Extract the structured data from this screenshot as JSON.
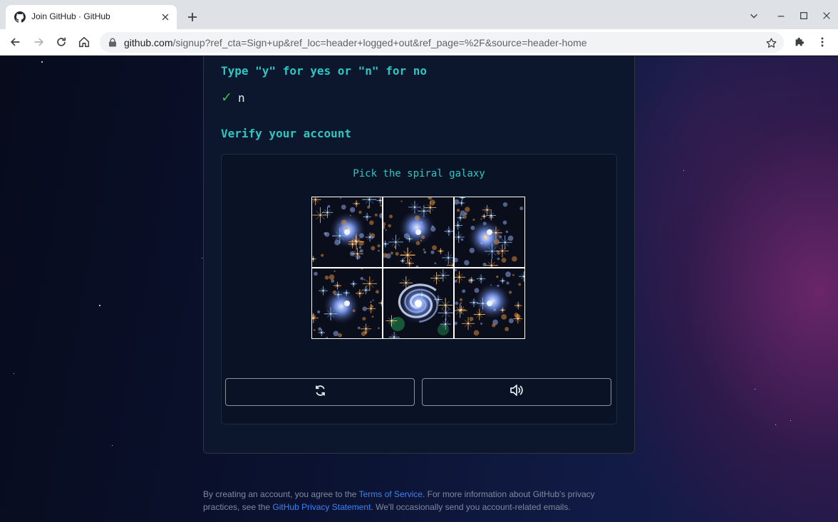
{
  "browser": {
    "tab_title": "Join GitHub · GitHub",
    "url_host": "github.com",
    "url_path": "/signup?ref_cta=Sign+up&ref_loc=header+logged+out&ref_page=%2F&source=header-home"
  },
  "signup": {
    "yes_no_prompt": "Type \"y\" for yes or \"n\" for no",
    "yes_no_answer": "n",
    "verify_title": "Verify your account"
  },
  "captcha": {
    "instruction": "Pick the spiral galaxy",
    "tiles": [
      "star-cluster",
      "star-cluster",
      "star-cluster",
      "star-cluster",
      "spiral-galaxy",
      "star-cluster"
    ]
  },
  "footer": {
    "text_before_terms": "By creating an account, you agree to the ",
    "terms_link": "Terms of Service",
    "text_middle": ". For more information about GitHub's privacy practices, see the ",
    "privacy_link": "GitHub Privacy Statement",
    "text_after": ". We'll occasionally send you account-related emails."
  },
  "colors": {
    "accent_teal": "#2ec7c0",
    "check_green": "#3fb950",
    "link_blue": "#3b82f6",
    "card_bg": "#0c162d"
  }
}
